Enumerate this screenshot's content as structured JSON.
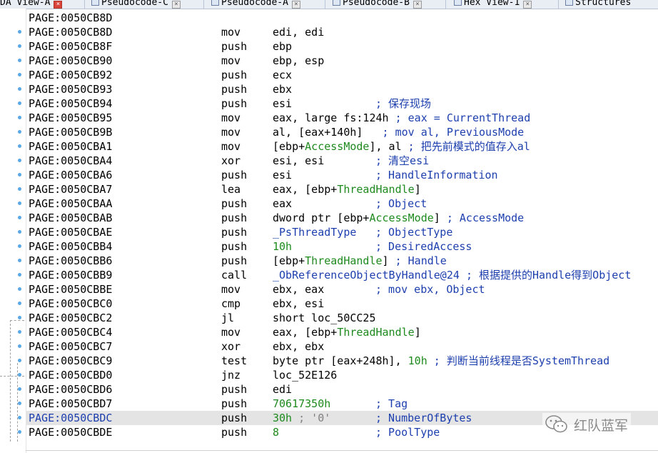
{
  "tabs": [
    {
      "label": "DA View-A",
      "active": true
    },
    {
      "label": "Pseudocode-C",
      "active": false
    },
    {
      "label": "Pseudocode-A",
      "active": false
    },
    {
      "label": "Pseudocode-B",
      "active": false
    },
    {
      "label": "Hex View-1",
      "active": false
    },
    {
      "label": "Structures",
      "active": false
    }
  ],
  "listing": [
    {
      "addr": "PAGE:0050CB8D",
      "parts": [],
      "dot": false
    },
    {
      "addr": "PAGE:0050CB8D",
      "mn": "mov",
      "parts": [
        {
          "t": "edi, edi",
          "c": "k"
        }
      ],
      "dot": true
    },
    {
      "addr": "PAGE:0050CB8F",
      "mn": "push",
      "parts": [
        {
          "t": "ebp",
          "c": "k"
        }
      ],
      "dot": true
    },
    {
      "addr": "PAGE:0050CB90",
      "mn": "mov",
      "parts": [
        {
          "t": "ebp, esp",
          "c": "k"
        }
      ],
      "dot": true
    },
    {
      "addr": "PAGE:0050CB92",
      "mn": "push",
      "parts": [
        {
          "t": "ecx",
          "c": "k"
        }
      ],
      "dot": true
    },
    {
      "addr": "PAGE:0050CB93",
      "mn": "push",
      "parts": [
        {
          "t": "ebx",
          "c": "k"
        }
      ],
      "dot": true
    },
    {
      "addr": "PAGE:0050CB94",
      "mn": "push",
      "parts": [
        {
          "t": "esi",
          "c": "k"
        }
      ],
      "comment": "; 保存现场",
      "dot": true
    },
    {
      "addr": "PAGE:0050CB95",
      "mn": "mov",
      "parts": [
        {
          "t": "eax, large fs:124h ",
          "c": "k"
        },
        {
          "t": "; eax = CurrentThread",
          "c": "cmi"
        }
      ],
      "dot": true
    },
    {
      "addr": "PAGE:0050CB9B",
      "mn": "mov",
      "parts": [
        {
          "t": "al, [eax+140h] ",
          "c": "k"
        },
        {
          "t": "  ; mov al, PreviousMode",
          "c": "cmi"
        }
      ],
      "dot": true
    },
    {
      "addr": "PAGE:0050CBA1",
      "mn": "mov",
      "parts": [
        {
          "t": "[ebp+",
          "c": "k"
        },
        {
          "t": "AccessMode",
          "c": "g"
        },
        {
          "t": "], al ",
          "c": "k"
        },
        {
          "t": "; 把先前模式的值存入al",
          "c": "cmi"
        }
      ],
      "dot": true
    },
    {
      "addr": "PAGE:0050CBA4",
      "mn": "xor",
      "parts": [
        {
          "t": "esi, esi",
          "c": "k"
        }
      ],
      "comment": "; 清空esi",
      "dot": true
    },
    {
      "addr": "PAGE:0050CBA6",
      "mn": "push",
      "parts": [
        {
          "t": "esi",
          "c": "k"
        }
      ],
      "comment": "; HandleInformation",
      "dot": true
    },
    {
      "addr": "PAGE:0050CBA7",
      "mn": "lea",
      "parts": [
        {
          "t": "eax, [ebp+",
          "c": "k"
        },
        {
          "t": "ThreadHandle",
          "c": "g"
        },
        {
          "t": "]",
          "c": "k"
        }
      ],
      "dot": true
    },
    {
      "addr": "PAGE:0050CBAA",
      "mn": "push",
      "parts": [
        {
          "t": "eax",
          "c": "k"
        }
      ],
      "comment": "; Object",
      "dot": true
    },
    {
      "addr": "PAGE:0050CBAB",
      "mn": "push",
      "parts": [
        {
          "t": "dword ptr [ebp+",
          "c": "k"
        },
        {
          "t": "AccessMode",
          "c": "g"
        },
        {
          "t": "] ",
          "c": "k"
        },
        {
          "t": "; AccessMode",
          "c": "cmi"
        }
      ],
      "dot": true
    },
    {
      "addr": "PAGE:0050CBAE",
      "mn": "push",
      "parts": [
        {
          "t": "_PsThreadType",
          "c": "cmi"
        }
      ],
      "comment": "; ObjectType",
      "dot": true
    },
    {
      "addr": "PAGE:0050CBB4",
      "mn": "push",
      "parts": [
        {
          "t": "10h",
          "c": "g"
        }
      ],
      "comment": "; DesiredAccess",
      "dot": true
    },
    {
      "addr": "PAGE:0050CBB6",
      "mn": "push",
      "parts": [
        {
          "t": "[ebp+",
          "c": "k"
        },
        {
          "t": "ThreadHandle",
          "c": "g"
        },
        {
          "t": "] ",
          "c": "k"
        },
        {
          "t": "; Handle",
          "c": "cmi"
        }
      ],
      "dot": true
    },
    {
      "addr": "PAGE:0050CBB9",
      "mn": "call",
      "parts": [
        {
          "t": "_ObReferenceObjectByHandle@24 ",
          "c": "cmi"
        },
        {
          "t": "; 根据提供的Handle得到Object",
          "c": "cmi"
        }
      ],
      "dot": true
    },
    {
      "addr": "PAGE:0050CBBE",
      "mn": "mov",
      "parts": [
        {
          "t": "ebx, eax",
          "c": "k"
        }
      ],
      "comment": "; mov ebx, Object",
      "dot": true
    },
    {
      "addr": "PAGE:0050CBC0",
      "mn": "cmp",
      "parts": [
        {
          "t": "ebx, esi",
          "c": "k"
        }
      ],
      "dot": true
    },
    {
      "addr": "PAGE:0050CBC2",
      "mn": "jl",
      "parts": [
        {
          "t": "short loc_50CC25",
          "c": "k"
        }
      ],
      "dot": true
    },
    {
      "addr": "PAGE:0050CBC4",
      "mn": "mov",
      "parts": [
        {
          "t": "eax, [ebp+",
          "c": "k"
        },
        {
          "t": "ThreadHandle",
          "c": "g"
        },
        {
          "t": "]",
          "c": "k"
        }
      ],
      "dot": true
    },
    {
      "addr": "PAGE:0050CBC7",
      "mn": "xor",
      "parts": [
        {
          "t": "ebx, ebx",
          "c": "k"
        }
      ],
      "dot": true
    },
    {
      "addr": "PAGE:0050CBC9",
      "mn": "test",
      "parts": [
        {
          "t": "byte ptr [eax+248h], ",
          "c": "k"
        },
        {
          "t": "10h",
          "c": "g"
        },
        {
          "t": " ",
          "c": "k"
        },
        {
          "t": "; 判断当前线程是否SystemThread",
          "c": "cmi"
        }
      ],
      "dot": true
    },
    {
      "addr": "PAGE:0050CBD0",
      "mn": "jnz",
      "parts": [
        {
          "t": "loc_52E126",
          "c": "k"
        }
      ],
      "dot": true
    },
    {
      "addr": "PAGE:0050CBD6",
      "mn": "push",
      "parts": [
        {
          "t": "edi",
          "c": "k"
        }
      ],
      "dot": true
    },
    {
      "addr": "PAGE:0050CBD7",
      "mn": "push",
      "parts": [
        {
          "t": "70617350h",
          "c": "g"
        }
      ],
      "comment": "; Tag",
      "dot": true
    },
    {
      "addr": "PAGE:0050CBDC",
      "mn": "push",
      "parts": [
        {
          "t": "30h",
          "c": "g"
        },
        {
          "t": " ; '0'",
          "c": "gray"
        }
      ],
      "comment": "; NumberOfBytes",
      "dot": true,
      "hl": true
    },
    {
      "addr": "PAGE:0050CBDE",
      "mn": "push",
      "parts": [
        {
          "t": "8",
          "c": "g"
        }
      ],
      "comment": "; PoolType",
      "dot": true
    }
  ],
  "watermark": {
    "text": "红队蓝军",
    "icon": "wechat-icon"
  }
}
